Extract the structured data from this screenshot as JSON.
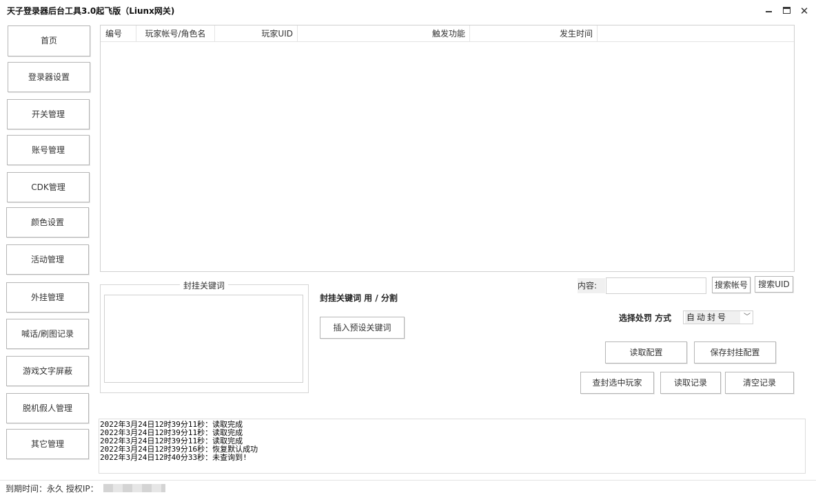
{
  "window": {
    "title": "天子登录器后台工具3.0起飞版（Liunx网关)"
  },
  "sidebar": {
    "items": [
      {
        "label": "首页"
      },
      {
        "label": "登录器设置"
      },
      {
        "label": "开关管理"
      },
      {
        "label": "账号管理"
      },
      {
        "label": "CDK管理"
      },
      {
        "label": "颜色设置"
      },
      {
        "label": "活动管理"
      },
      {
        "label": "外挂管理"
      },
      {
        "label": "喊话/刷图记录"
      },
      {
        "label": "游戏文字屏蔽"
      },
      {
        "label": "脱机假人管理"
      },
      {
        "label": "其它管理"
      }
    ]
  },
  "table": {
    "columns": [
      "编号",
      "玩家帐号/角色名",
      "玩家UID",
      "触发功能",
      "发生时间"
    ],
    "rows": []
  },
  "keywords": {
    "group_title": "封挂关键词",
    "value": "",
    "hint": "封挂关键词 用 / 分割",
    "insert_button": "插入预设关键词"
  },
  "search": {
    "label": "内容:",
    "value": "",
    "search_account_button": "搜索帐号",
    "search_uid_button": "搜索UID"
  },
  "penalty": {
    "label": "选择处罚 方式",
    "selected": "自动封号"
  },
  "actions": {
    "read_config": "读取配置",
    "save_config": "保存封挂配置",
    "ban_selected": "查封选中玩家",
    "read_records": "读取记录",
    "clear_records": "清空记录"
  },
  "log": {
    "lines": [
      "2022年3月24日12时39分11秒：读取完成",
      "2022年3月24日12时39分11秒：读取完成",
      "2022年3月24日12时39分11秒：读取完成",
      "2022年3月24日12时39分16秒：恢复默认成功",
      "2022年3月24日12时40分33秒：未查询到!"
    ]
  },
  "status": {
    "text": "到期时间：永久  授权IP："
  }
}
